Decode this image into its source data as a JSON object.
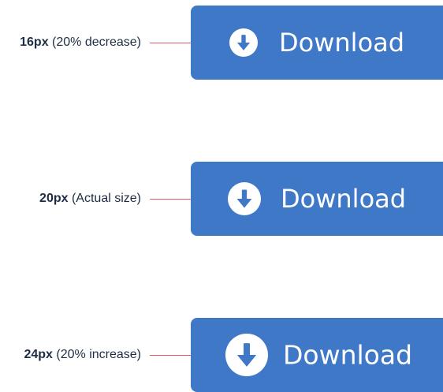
{
  "rows": [
    {
      "size": "16px",
      "note": "(20% decrease)",
      "button_label": "Download",
      "icon": "download-circle-icon"
    },
    {
      "size": "20px",
      "note": "(Actual size)",
      "button_label": "Download",
      "icon": "download-circle-icon"
    },
    {
      "size": "24px",
      "note": "(20% increase)",
      "button_label": "Download",
      "icon": "download-circle-icon"
    }
  ],
  "colors": {
    "button_background": "#3f78c6",
    "label_text": "#1f2d44",
    "connector_line": "#e4566a"
  }
}
